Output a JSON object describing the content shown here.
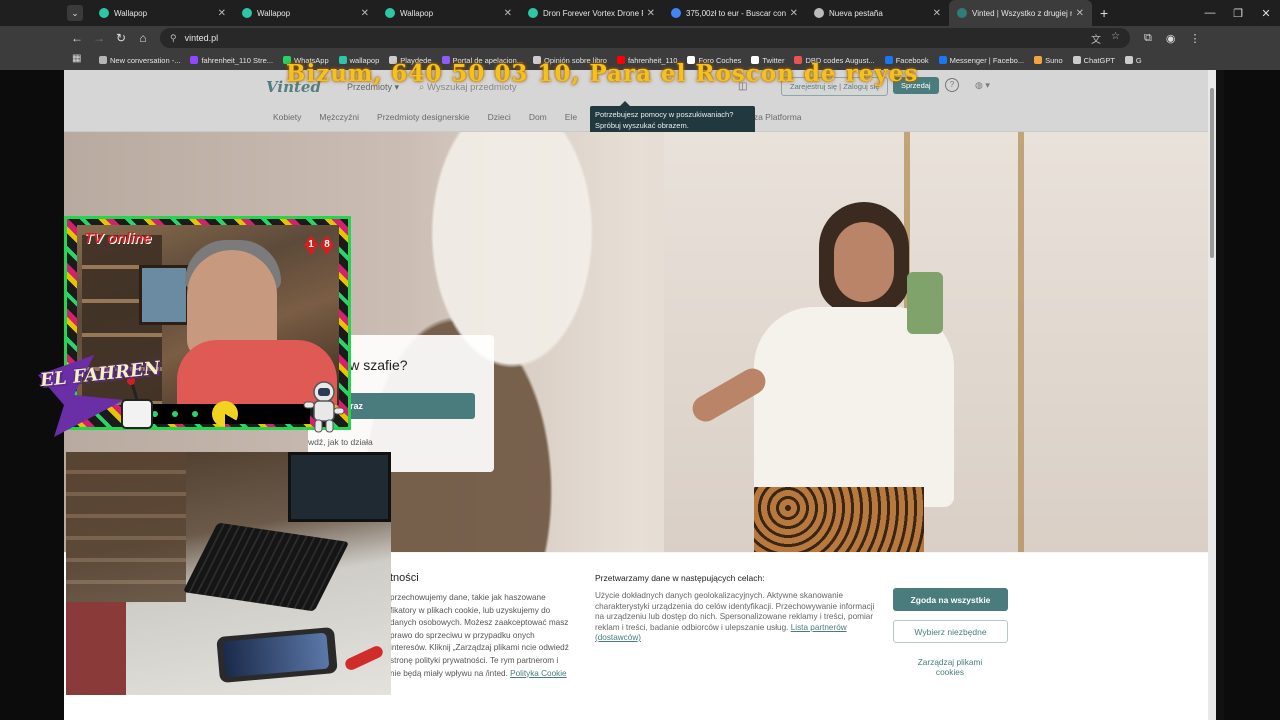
{
  "browser": {
    "tabs": [
      {
        "label": "Wallapop",
        "color": "#2fc5a7"
      },
      {
        "label": "Wallapop",
        "color": "#2fc5a7"
      },
      {
        "label": "Wallapop",
        "color": "#2fc5a7"
      },
      {
        "label": "Dron Forever Vortex Drone Rc",
        "color": "#2fc5a7"
      },
      {
        "label": "375,00zł to eur - Buscar con G",
        "color": "#4285f4"
      },
      {
        "label": "Nueva pestaña",
        "color": "#bbbbbb"
      },
      {
        "label": "Vinted | Wszystko z drugiej ręki",
        "color": "#2f7c7a",
        "active": true
      }
    ],
    "url": "vinted.pl",
    "bookmarks": [
      {
        "label": "New conversation -...",
        "color": "#b6b6b6"
      },
      {
        "label": "fahrenheit_110 Stre...",
        "color": "#9146ff"
      },
      {
        "label": "WhatsApp",
        "color": "#25d366"
      },
      {
        "label": "wallapop",
        "color": "#2fc5a7"
      },
      {
        "label": "Playdede",
        "color": "#cccccc"
      },
      {
        "label": "Portal de apelacion...",
        "color": "#8e5cf7"
      },
      {
        "label": "Opinión sobre libro",
        "color": "#cccccc"
      },
      {
        "label": "fahrenheit_110",
        "color": "#ff0000"
      },
      {
        "label": "Foro Coches",
        "color": "#ffffff"
      },
      {
        "label": "Twitter",
        "color": "#ffffff"
      },
      {
        "label": "DBD codes August...",
        "color": "#e8554e"
      },
      {
        "label": "Facebook",
        "color": "#1877f2"
      },
      {
        "label": "Messenger | Facebo...",
        "color": "#1877f2"
      },
      {
        "label": "Suno",
        "color": "#f4a340"
      },
      {
        "label": "ChatGPT",
        "color": "#cccccc"
      },
      {
        "label": "G",
        "color": "#cccccc"
      }
    ]
  },
  "overlay": {
    "banner": "Bizum, 640 50 03 10, Para el Roscon de reyes",
    "tv_online": "TV online",
    "age": [
      "1",
      "8"
    ],
    "fahren_label": "EL FAHREN"
  },
  "vinted": {
    "logo": "Vinted",
    "category": "Przedmioty",
    "search_placeholder": "Wyszukaj przedmioty",
    "login": "Zarejestruj się | Zaloguj się",
    "sell": "Sprzedaj",
    "nav": [
      "Kobiety",
      "Mężczyźni",
      "Przedmioty designerskie",
      "Dzieci",
      "Dom",
      "Ele",
      "ionerstwo",
      "Sport",
      "O Vinted",
      "Nasza Platforma"
    ],
    "tooltip": "Potrzebujesz pomocy w poszukiwaniach? Spróbuj wyszukać obrazem.",
    "hero_title": "miany w szafie?",
    "hero_button": "przedaj teraz",
    "hero_link": "wdź, jak to działa"
  },
  "cookie": {
    "title": "tności",
    "text1": "przechowujemy dane, takie jak haszowane fikatory w plikach cookie, lub uzyskujemy do danych osobowych. Możesz zaakceptować masz prawo do sprzeciwu w przypadku onych interesów. Kliknij „Zarządzaj plikami ncie odwiedź stronę polityki prywatności. Te rym partnerom i nie będą miały wpływu na /inted.",
    "cookie_policy_link": "Polityka Cookie",
    "col2_title": "Przetwarzamy dane w następujących celach:",
    "text2": "Użycie dokładnych danych geolokalizacyjnych. Aktywne skanowanie charakterystyki urządzenia do celów identyfikacji. Przechowywanie informacji na urządzeniu lub dostęp do nich. Spersonalizowane reklamy i treści, pomiar reklam i treści, badanie odbiorców i ulepszanie usług.",
    "partners_link": "Lista partnerów (dostawców)",
    "accept_all": "Zgoda na wszystkie",
    "choose": "Wybierz niezbędne",
    "manage": "Zarządzaj plikami cookies"
  }
}
